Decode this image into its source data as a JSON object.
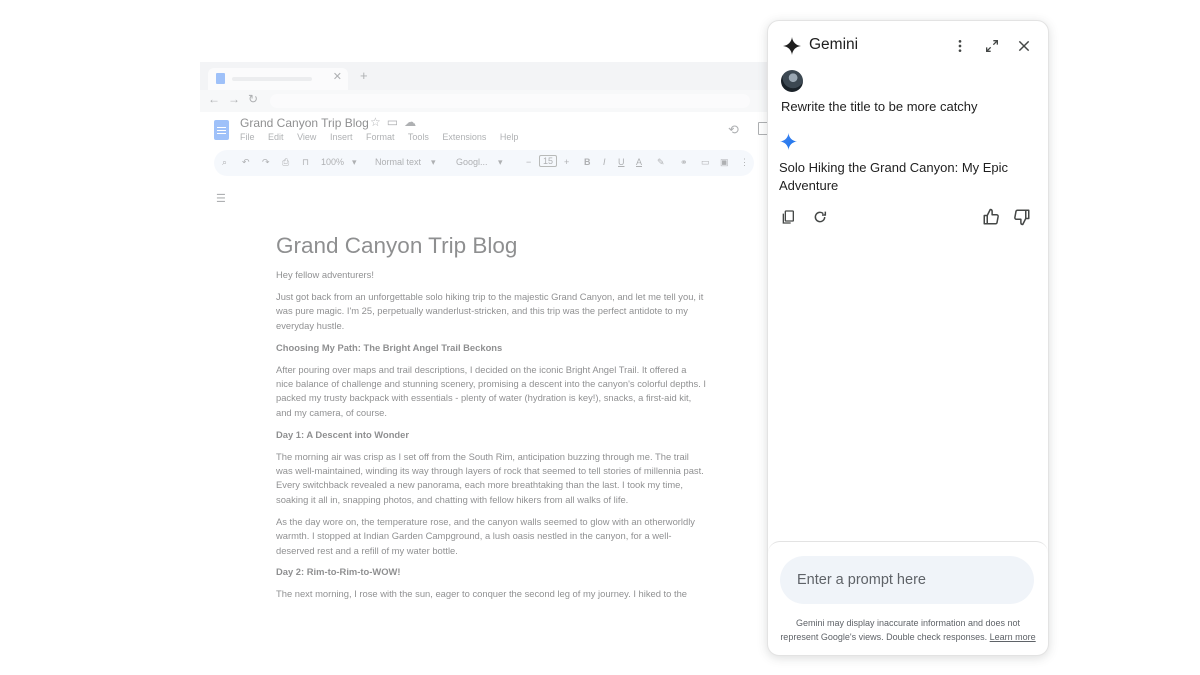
{
  "docs": {
    "title": "Grand Canyon Trip Blog",
    "menu": [
      "File",
      "Edit",
      "View",
      "Insert",
      "Format",
      "Tools",
      "Extensions",
      "Help"
    ],
    "toolbar": {
      "zoom": "100%",
      "style": "Normal text",
      "font": "Googl...",
      "font_size": "15",
      "minus": "−",
      "plus": "+"
    },
    "content": {
      "heading": "Grand Canyon Trip Blog",
      "blocks": [
        {
          "type": "p",
          "text": "Hey fellow adventurers!"
        },
        {
          "type": "p",
          "text": "Just got back from an unforgettable solo hiking trip to the majestic Grand Canyon, and let me tell you, it was pure magic. I'm 25, perpetually wanderlust-stricken, and this trip was the perfect antidote to my everyday hustle."
        },
        {
          "type": "h",
          "text": "Choosing My Path: The Bright Angel Trail Beckons"
        },
        {
          "type": "p",
          "text": "After pouring over maps and trail descriptions, I decided on the iconic Bright Angel Trail. It offered a nice balance of challenge and stunning scenery, promising a descent into the canyon's colorful depths. I packed my trusty backpack with essentials - plenty of water (hydration is key!), snacks, a first-aid kit, and my camera, of course."
        },
        {
          "type": "h",
          "text": "Day 1: A Descent into Wonder"
        },
        {
          "type": "p",
          "text": "The morning air was crisp as I set off from the South Rim, anticipation buzzing through me. The trail was well-maintained, winding its way through layers of rock that seemed to tell stories of millennia past. Every switchback revealed a new panorama, each more breathtaking than the last. I took my time, soaking it all in, snapping photos, and chatting with fellow hikers from all walks of life."
        },
        {
          "type": "p",
          "text": "As the day wore on, the temperature rose, and the canyon walls seemed to glow with an otherworldly warmth. I stopped at Indian Garden Campground, a lush oasis nestled in the canyon, for a well-deserved rest and a refill of my water bottle."
        },
        {
          "type": "h",
          "text": "Day 2: Rim-to-Rim-to-WOW!"
        },
        {
          "type": "p",
          "text": "The next morning, I rose with the sun, eager to conquer the second leg of my journey. I hiked to the"
        }
      ]
    }
  },
  "gemini": {
    "title": "Gemini",
    "user_prompt": "Rewrite the title to be more catchy",
    "response": "Solo Hiking the Grand Canyon: My Epic Adventure",
    "input_placeholder": "Enter a prompt here",
    "disclaimer": "Gemini may display inaccurate information and does not represent Google's views. Double check responses.",
    "learn_more": "Learn more",
    "icons": {
      "header": [
        "more-vert-icon",
        "expand-icon",
        "close-icon"
      ],
      "actions": [
        "copy-icon",
        "regenerate-icon",
        "thumbs-up-icon",
        "thumbs-down-icon"
      ]
    },
    "colors": {
      "spark_dark": "#1f1f1f",
      "spark_blue": "#4285f4",
      "input_bg": "#f0f4f9"
    }
  }
}
